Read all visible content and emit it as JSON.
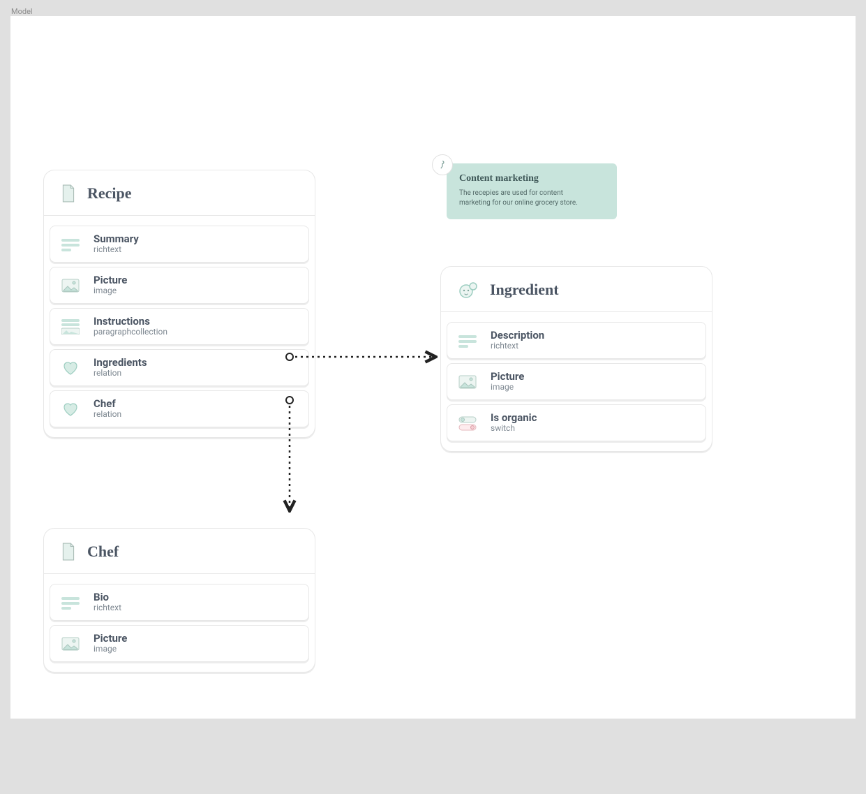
{
  "frame_label": "Model",
  "info": {
    "title": "Content marketing",
    "text": "The recepies are used for content marketing for our online grocery store."
  },
  "models": {
    "recipe": {
      "title": "Recipe",
      "icon": "document",
      "fields": [
        {
          "name": "Summary",
          "type": "richtext",
          "icon": "richtext"
        },
        {
          "name": "Picture",
          "type": "image",
          "icon": "image"
        },
        {
          "name": "Instructions",
          "type": "paragraphcollection",
          "icon": "paragraph"
        },
        {
          "name": "Ingredients",
          "type": "relation",
          "icon": "relation"
        },
        {
          "name": "Chef",
          "type": "relation",
          "icon": "relation"
        }
      ]
    },
    "ingredient": {
      "title": "Ingredient",
      "icon": "bear",
      "fields": [
        {
          "name": "Description",
          "type": "richtext",
          "icon": "richtext"
        },
        {
          "name": "Picture",
          "type": "image",
          "icon": "image"
        },
        {
          "name": "Is organic",
          "type": "switch",
          "icon": "switch"
        }
      ]
    },
    "chef": {
      "title": "Chef",
      "icon": "document",
      "fields": [
        {
          "name": "Bio",
          "type": "richtext",
          "icon": "richtext"
        },
        {
          "name": "Picture",
          "type": "image",
          "icon": "image"
        }
      ]
    }
  },
  "relations": [
    {
      "from": "recipe.Ingredients",
      "to": "ingredient"
    },
    {
      "from": "recipe.Chef",
      "to": "chef"
    }
  ]
}
